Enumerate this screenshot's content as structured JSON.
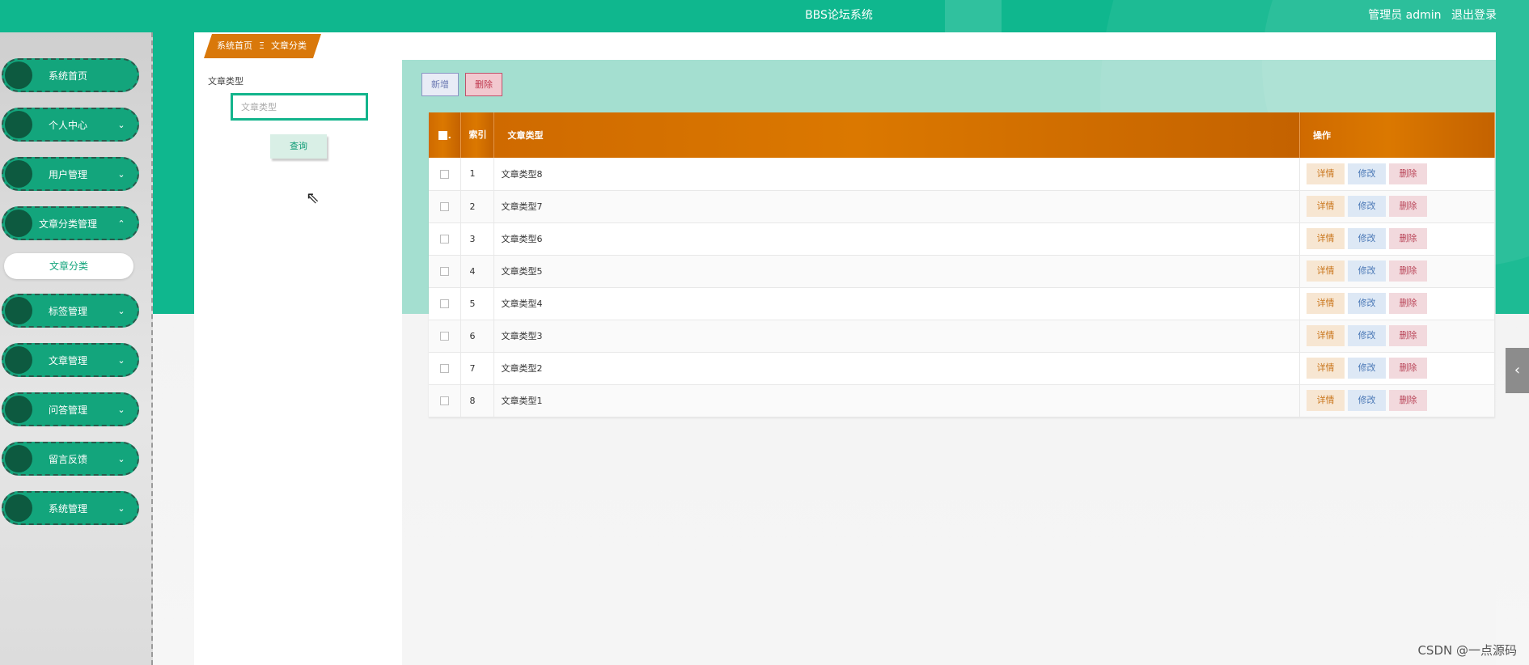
{
  "header": {
    "site_title": "BBS论坛系统",
    "user_label": "管理员 admin",
    "logout_label": "退出登录"
  },
  "sidebar": {
    "items": [
      {
        "label": "系统首页",
        "chevron": ""
      },
      {
        "label": "个人中心",
        "chevron": "⌄"
      },
      {
        "label": "用户管理",
        "chevron": "⌄"
      },
      {
        "label": "文章分类管理",
        "chevron": "⌃"
      },
      {
        "label": "标签管理",
        "chevron": "⌄"
      },
      {
        "label": "文章管理",
        "chevron": "⌄"
      },
      {
        "label": "问答管理",
        "chevron": "⌄"
      },
      {
        "label": "留言反馈",
        "chevron": "⌄"
      },
      {
        "label": "系统管理",
        "chevron": "⌄"
      }
    ],
    "submenu_active": "文章分类"
  },
  "breadcrumb": {
    "home": "系统首页",
    "separator": "Ξ",
    "current": "文章分类"
  },
  "search": {
    "label": "文章类型",
    "placeholder": "文章类型",
    "query_button": "查询"
  },
  "toolbar": {
    "add_label": "新增",
    "delete_label": "删除"
  },
  "table": {
    "headers": {
      "index": "索引",
      "type": "文章类型",
      "ops": "操作"
    },
    "rows": [
      {
        "index": "1",
        "type": "文章类型8"
      },
      {
        "index": "2",
        "type": "文章类型7"
      },
      {
        "index": "3",
        "type": "文章类型6"
      },
      {
        "index": "4",
        "type": "文章类型5"
      },
      {
        "index": "5",
        "type": "文章类型4"
      },
      {
        "index": "6",
        "type": "文章类型3"
      },
      {
        "index": "7",
        "type": "文章类型2"
      },
      {
        "index": "8",
        "type": "文章类型1"
      }
    ],
    "row_actions": {
      "detail": "详情",
      "edit": "修改",
      "delete": "删除"
    }
  },
  "side_tab_icon": "‹",
  "watermark": "CSDN @一点源码",
  "colors": {
    "primary": "#0fb78e",
    "accent_orange": "#d9780a",
    "menu_green": "#13a57c"
  }
}
